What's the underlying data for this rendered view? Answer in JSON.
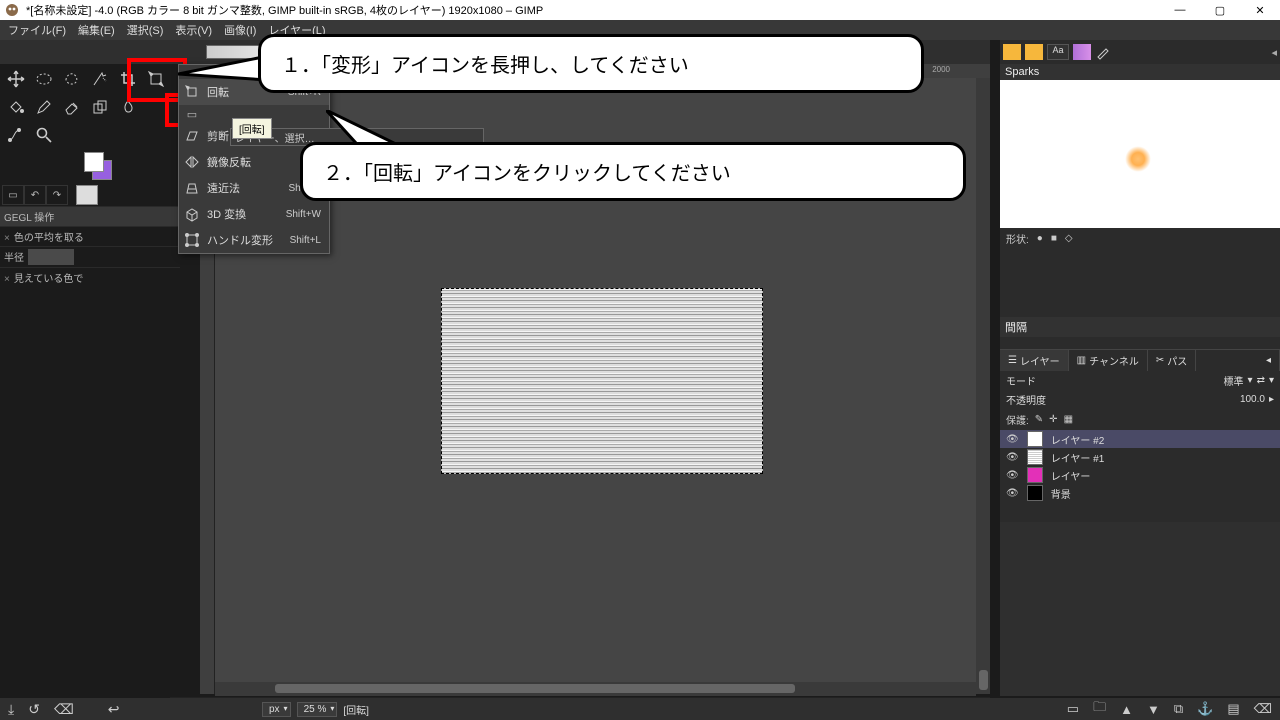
{
  "titlebar": {
    "icon": "gimp",
    "title": "*[名称未設定] -4.0 (RGB カラー 8 bit ガンマ整数, GIMP built-in sRGB, 4枚のレイヤー) 1920x1080 – GIMP"
  },
  "winbuttons": {
    "min": "—",
    "max": "▢",
    "close": "✕"
  },
  "menu": [
    "ファイル(F)",
    "編集(E)",
    "選択(S)",
    "表示(V)",
    "画像(I)",
    "レイヤー(L)"
  ],
  "tool_options": {
    "gegl": "GEGL 操作",
    "avg": "色の平均を取る",
    "radius_label": "半径",
    "radius_val": "",
    "visible": "見えている色で"
  },
  "dropdown": {
    "rotate": "回転",
    "rotate_sc": "Shift+R",
    "tooltip": "[回転]",
    "mask": "レイヤー、選択…",
    "shear": "剪断…",
    "flip": "鏡像反転",
    "flip_sc": "Sh",
    "perspective": "遠近法",
    "perspective_sc": "Shift+P",
    "t3d": "3D 変換",
    "t3d_sc": "Shift+W",
    "handle": "ハンドル変形",
    "handle_sc": "Shift+L"
  },
  "callout1": "１．「変形」アイコンを長押し、してください",
  "callout2": "２．「回転」アイコンをクリックしてください",
  "right": {
    "sparks": "Sparks",
    "shape": "形状:",
    "spacing": "間隔",
    "tab_layer": "レイヤー",
    "tab_channel": "チャンネル",
    "tab_path": "パス",
    "mode": "モード",
    "mode_val": "標準",
    "opacity": "不透明度",
    "opacity_val": "100.0",
    "protect": "保護:",
    "layers": [
      "レイヤー  #2",
      "レイヤー  #1",
      "レイヤー",
      "背景"
    ]
  },
  "bottom": {
    "px": "px",
    "zoom": "25 %",
    "tool": "[回転]"
  },
  "ruler": {
    "n2000": "2000"
  }
}
